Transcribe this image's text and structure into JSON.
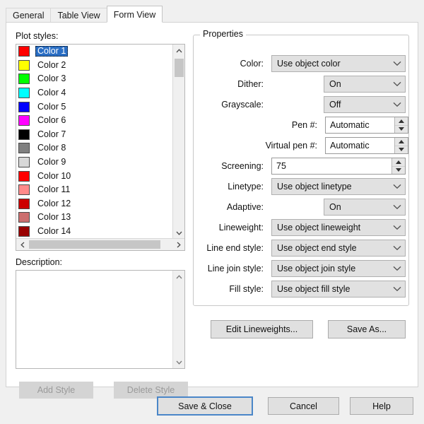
{
  "tabs": [
    {
      "label": "General",
      "active": false
    },
    {
      "label": "Table View",
      "active": false
    },
    {
      "label": "Form View",
      "active": true
    }
  ],
  "left_panel": {
    "plot_styles_label": "Plot styles:",
    "description_label": "Description:",
    "description_value": "",
    "plot_styles": [
      {
        "name": "Color 1",
        "color": "#ff0000",
        "selected": true
      },
      {
        "name": "Color 2",
        "color": "#ffff00",
        "selected": false
      },
      {
        "name": "Color 3",
        "color": "#00ff00",
        "selected": false
      },
      {
        "name": "Color 4",
        "color": "#00ffff",
        "selected": false
      },
      {
        "name": "Color 5",
        "color": "#0000ff",
        "selected": false
      },
      {
        "name": "Color 6",
        "color": "#ff00ff",
        "selected": false
      },
      {
        "name": "Color 7",
        "color": "#000000",
        "selected": false
      },
      {
        "name": "Color 8",
        "color": "#808080",
        "selected": false
      },
      {
        "name": "Color 9",
        "color": "#d8d8d8",
        "selected": false
      },
      {
        "name": "Color 10",
        "color": "#ff0000",
        "selected": false
      },
      {
        "name": "Color 11",
        "color": "#ff8a8a",
        "selected": false
      },
      {
        "name": "Color 12",
        "color": "#cc0000",
        "selected": false
      },
      {
        "name": "Color 13",
        "color": "#cc6e6e",
        "selected": false
      },
      {
        "name": "Color 14",
        "color": "#990000",
        "selected": false
      }
    ],
    "add_style_label": "Add Style",
    "delete_style_label": "Delete Style"
  },
  "properties": {
    "legend": "Properties",
    "fields": [
      {
        "label": "Color:",
        "value": "Use object color",
        "type": "combo"
      },
      {
        "label": "Dither:",
        "value": "On",
        "type": "combo"
      },
      {
        "label": "Grayscale:",
        "value": "Off",
        "type": "combo"
      },
      {
        "label": "Pen #:",
        "value": "Automatic",
        "type": "spin"
      },
      {
        "label": "Virtual pen #:",
        "value": "Automatic",
        "type": "spin"
      },
      {
        "label": "Screening:",
        "value": "75",
        "type": "spin"
      },
      {
        "label": "Linetype:",
        "value": "Use object linetype",
        "type": "combo"
      },
      {
        "label": "Adaptive:",
        "value": "On",
        "type": "combo"
      },
      {
        "label": "Lineweight:",
        "value": "Use object lineweight",
        "type": "combo"
      },
      {
        "label": "Line end style:",
        "value": "Use object end style",
        "type": "combo"
      },
      {
        "label": "Line join style:",
        "value": "Use object join style",
        "type": "combo"
      },
      {
        "label": "Fill style:",
        "value": "Use object fill style",
        "type": "combo"
      }
    ],
    "edit_lineweights_label": "Edit Lineweights...",
    "save_as_label": "Save As..."
  },
  "footer": {
    "save_close_label": "Save & Close",
    "cancel_label": "Cancel",
    "help_label": "Help"
  },
  "colors": {
    "selection_blue": "#2a6ec4",
    "default_button_focus": "#4a86c8",
    "panel_bg": "#ffffff",
    "dialog_bg": "#f0f0f0"
  }
}
